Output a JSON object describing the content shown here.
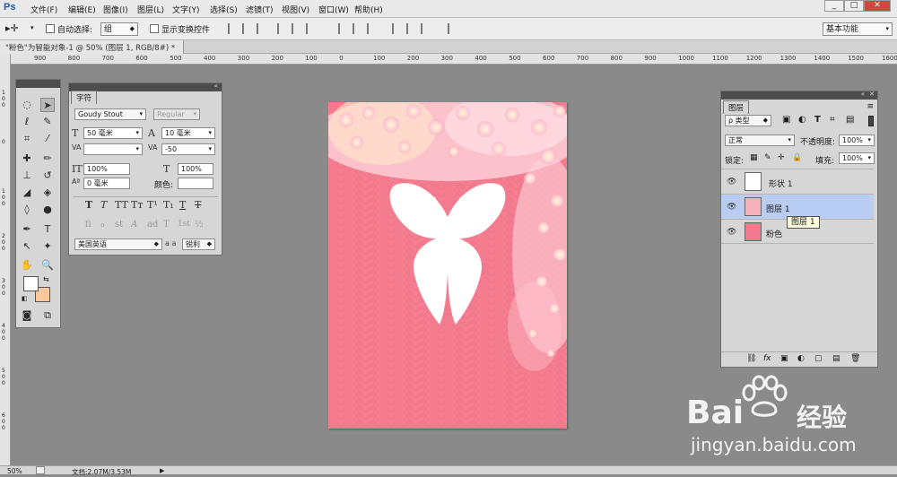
{
  "app": {
    "logo": "Ps"
  },
  "menu": [
    "文件(F)",
    "编辑(E)",
    "图像(I)",
    "图层(L)",
    "文字(Y)",
    "选择(S)",
    "滤镜(T)",
    "视图(V)",
    "窗口(W)",
    "帮助(H)"
  ],
  "window_controls": [
    "_",
    "□",
    "✕"
  ],
  "options": {
    "auto_select_label": "自动选择:",
    "auto_select_value": "组",
    "show_transform_label": "显示变换控件",
    "workspace": "基本功能"
  },
  "document": {
    "tab_title": "\"粉色\"为智能对象-1 @ 50% (图层 1, RGB/8#) *",
    "tab_close": "×"
  },
  "ruler": {
    "marks": [
      "900",
      "800",
      "700",
      "600",
      "500",
      "400",
      "300",
      "200",
      "100",
      "0",
      "100",
      "200",
      "300",
      "400",
      "500",
      "600",
      "700",
      "800",
      "900",
      "1000",
      "1100",
      "1200",
      "1300",
      "1400",
      "1500",
      "1600"
    ]
  },
  "character_panel": {
    "tab": "字符",
    "font_family": "Goudy Stout",
    "font_style": "Regular",
    "font_size": "50 毫米",
    "leading": "10 毫米",
    "kerning": "",
    "tracking": "-50",
    "vscale": "100%",
    "hscale": "100%",
    "baseline": "0 毫米",
    "color_label": "颜色:",
    "language": "美国英语",
    "aa_icon": "a a",
    "antialias": "锐利",
    "glyphs": [
      "T",
      "T",
      "TT",
      "Tт",
      "T¹",
      "T₁",
      "T",
      "T"
    ],
    "ot_glyphs": [
      "fi",
      "ℴ",
      "st",
      "A",
      "ad",
      "T",
      "1st",
      "½"
    ]
  },
  "layers_panel": {
    "tab": "图层",
    "filter": "ρ 类型",
    "blend_mode": "正常",
    "opacity_label": "不透明度:",
    "opacity": "100%",
    "lock_label": "锁定:",
    "fill_label": "填充:",
    "fill": "100%",
    "layers": [
      {
        "name": "形状 1",
        "visible": true,
        "selected": false
      },
      {
        "name": "图层 1",
        "visible": true,
        "selected": true
      },
      {
        "name": "粉色",
        "visible": true,
        "selected": false
      }
    ],
    "tooltip": "图层 1",
    "bottom_icons": [
      "⛓",
      "fx",
      "▣",
      "◐",
      "▢",
      "▤",
      "🗑"
    ]
  },
  "status": {
    "zoom": "50%",
    "doc_info": "文档:2.07M/3.53M"
  },
  "watermark": {
    "brand": "Bai",
    "brand2": "经验",
    "url": "jingyan.baidu.com"
  },
  "colors": {
    "canvas_pink": "#f27a8c",
    "foreground": "#ffffff",
    "background": "#fcc79a",
    "layer_selected": "#b9cdf3"
  }
}
